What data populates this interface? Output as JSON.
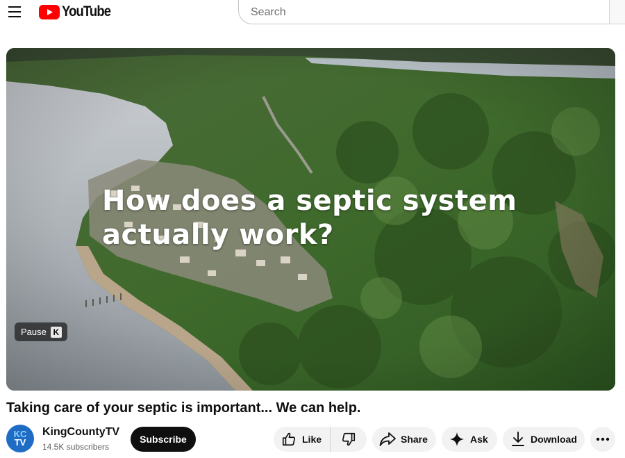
{
  "masthead": {
    "logo_text": "YouTube",
    "search_placeholder": "Search"
  },
  "player": {
    "overlay_title_line1": "How does a septic system",
    "overlay_title_line2": "actually work?",
    "pause_tooltip_label": "Pause",
    "pause_tooltip_key": "K"
  },
  "video": {
    "title": "Taking care of your septic is important... We can help."
  },
  "channel": {
    "avatar_line1": "KC",
    "avatar_line2": "TV",
    "name": "KingCountyTV",
    "subscribers": "14.5K subscribers",
    "subscribe_label": "Subscribe"
  },
  "actions": {
    "like_label": "Like",
    "share_label": "Share",
    "ask_label": "Ask",
    "download_label": "Download"
  },
  "icons": [
    "menu-icon",
    "youtube-logo-icon",
    "like-icon",
    "dislike-icon",
    "share-icon",
    "ask-sparkle-icon",
    "download-icon",
    "more-icon"
  ],
  "colors": {
    "brand_red": "#ff0000",
    "subscribe_bg": "#0f0f0f",
    "pill_bg": "#f2f2f2"
  }
}
